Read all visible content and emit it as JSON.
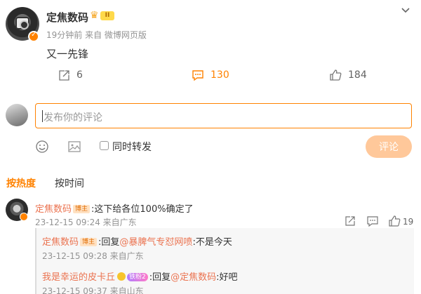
{
  "post": {
    "author": "定焦数码",
    "vip_level": "II",
    "time_ago": "19分钟前",
    "source": "来自 微博网页版",
    "text": "又一先锋",
    "reposts": "6",
    "comments": "130",
    "likes": "184"
  },
  "compose": {
    "placeholder": "发布你的评论",
    "repost_label": "同时转发",
    "submit_label": "评论"
  },
  "sort": {
    "hot": "按热度",
    "time": "按时间"
  },
  "comment": {
    "author": "定焦数码",
    "host_badge": "博主",
    "text": ":这下给各位100%确定了",
    "time": "23-12-15 09:24 来自广东",
    "like_count": "19"
  },
  "replies": [
    {
      "author": "定焦数码",
      "host_badge": "博主",
      "reply_prefix": ":回复",
      "mention": "@暴脾气专怼网喷",
      "text": ":不是今天",
      "time": "23-12-15 09:28 来自广东"
    },
    {
      "author": "我是幸运的皮卡丘",
      "fan_badge": "铁粉2",
      "reply_prefix": ":回复",
      "mention": "@定焦数码",
      "text": ":好吧",
      "time": "23-12-15 09:37 来自山东"
    }
  ],
  "colors": {
    "accent": "#ff8200",
    "link": "#eb7350",
    "muted": "#939393"
  }
}
